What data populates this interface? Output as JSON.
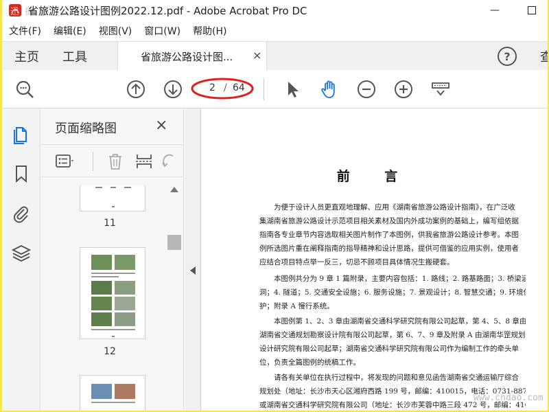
{
  "window": {
    "title": "省旅游公路设计图例2022.12.pdf - Adobe Acrobat Pro DC",
    "watermark_logo": "迅 捷 网",
    "minimize": "—",
    "maximize": "☐"
  },
  "menu": {
    "items": [
      "文件(F)",
      "编辑(E)",
      "视图(V)",
      "窗口(W)",
      "帮助(H)"
    ]
  },
  "tabs": {
    "home": "主页",
    "tools": "工具",
    "document": "省旅游公路设计图...",
    "close": "×",
    "help": "?",
    "truncated": "查"
  },
  "toolbar": {
    "current_page": "2",
    "separator": "/",
    "total_pages": "64",
    "highlight_color": "#e02020",
    "accent_color": "#1473e6"
  },
  "panel": {
    "title": "页面缩略图",
    "close": "×",
    "thumbnails": [
      {
        "number": "11"
      },
      {
        "number": "12"
      }
    ]
  },
  "document": {
    "heading": "前 言",
    "paragraphs": [
      [
        "　　为便于设计人员更直观地理解、应用《湖南省旅游公路设计指南》，在广泛收",
        "集湖南省旅游公路设计示范项目相关素材及国内外成功案例的基础上，编写组依据",
        "指南各专业章节内容选取相关图片制作了本图例，供我省旅游公路设计参考。本图",
        "例所选图片重在阐释指南的指导精神和设计思路，提供可借鉴的应用实例，使用者",
        "应结合项目特点举一反三，切忌不顾项目具体情况生搬硬套。"
      ],
      [
        "　　本图例共分为 9 章 1 篇附录，主要内容包括：1. 路线；2. 路基路面；3. 桥梁涵",
        "洞；4. 隧道；5. 交通安全设施；6. 服务设施；7. 景观设计；8. 智慧交通；9. 环境保",
        "护；附录 A 慢行系统。"
      ],
      [
        "　　本图例第 1、2、3 章由湖南省交通科学研究院有限公司起草，第 4、5、8 章由",
        "湖南省交通规划勘察设计院有限公司起草，第 6、7、9 章及附录 A 由湖南华罡规划",
        "设计研究院有限公司起草；湖南省交通科学研究院有限公司作为编制工作的牵头单",
        "位，负责全篇图例的统稿工作。"
      ],
      [
        "　　请各有关单位在执行过程中，将发现的问题和意见函告湖南省交通运输厅综合",
        "规划处（地址：长沙市天心区湘府西路 199 号，邮编：410015，电话：0731-88770235）",
        "或湖南省交通科学研究院有限公司（地址：长沙市芙蓉中路三段 472 号，邮编：410015，"
      ]
    ]
  },
  "watermark_url": "www.cndao.com"
}
